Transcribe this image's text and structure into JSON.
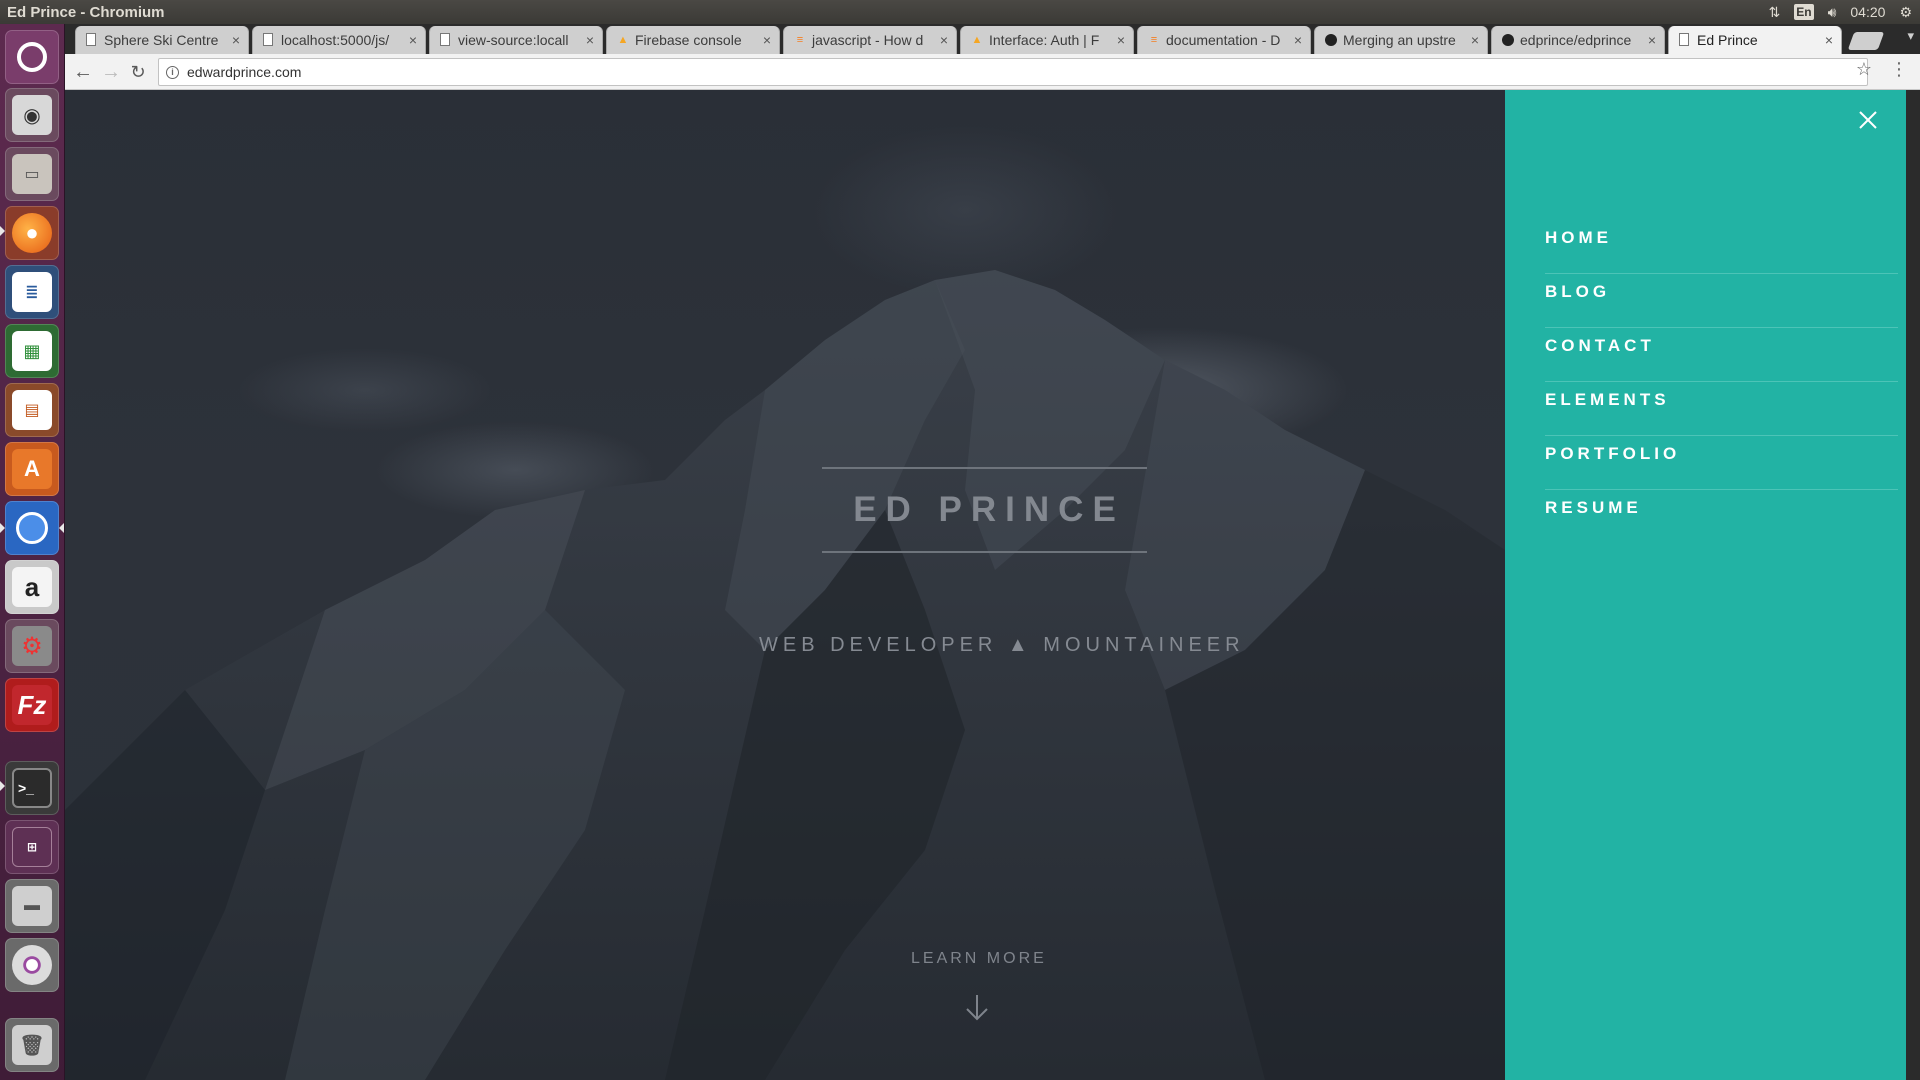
{
  "window": {
    "title": "Ed Prince - Chromium"
  },
  "panel": {
    "lang": "En",
    "clock": "04:20"
  },
  "launcher": {
    "items": [
      {
        "name": "ubuntu-dash-icon"
      },
      {
        "name": "screenshot-camera-icon"
      },
      {
        "name": "files-icon"
      },
      {
        "name": "firefox-icon"
      },
      {
        "name": "writer-icon"
      },
      {
        "name": "calc-icon"
      },
      {
        "name": "impress-icon"
      },
      {
        "name": "software-center-icon"
      },
      {
        "name": "chromium-icon"
      },
      {
        "name": "amazon-icon"
      },
      {
        "name": "system-settings-icon"
      },
      {
        "name": "filezilla-icon"
      },
      {
        "name": "terminal-icon"
      },
      {
        "name": "workspace-switcher-icon"
      },
      {
        "name": "drive-icon"
      },
      {
        "name": "dvd-icon"
      },
      {
        "name": "trash-icon"
      }
    ]
  },
  "tabs": [
    {
      "title": "Sphere Ski Centre",
      "favicon": "doc"
    },
    {
      "title": "localhost:5000/js/",
      "favicon": "doc"
    },
    {
      "title": "view-source:locall",
      "favicon": "doc"
    },
    {
      "title": "Firebase console",
      "favicon": "firebase"
    },
    {
      "title": "javascript - How d",
      "favicon": "stackoverflow"
    },
    {
      "title": "Interface: Auth | F",
      "favicon": "firebase"
    },
    {
      "title": "documentation - D",
      "favicon": "stackoverflow"
    },
    {
      "title": "Merging an upstre",
      "favicon": "github"
    },
    {
      "title": "edprince/edprince",
      "favicon": "github"
    },
    {
      "title": "Ed Prince",
      "favicon": "doc",
      "active": true
    }
  ],
  "toolbar": {
    "url": "edwardprince.com"
  },
  "hero": {
    "title": "ED PRINCE",
    "subtitle": "WEB DEVELOPER ▲ MOUNTAINEER",
    "cta": "LEARN MORE"
  },
  "nav": {
    "items": [
      {
        "label": "HOME"
      },
      {
        "label": "BLOG"
      },
      {
        "label": "CONTACT"
      },
      {
        "label": "ELEMENTS"
      },
      {
        "label": "PORTFOLIO"
      },
      {
        "label": "RESUME"
      }
    ]
  },
  "colors": {
    "panel_teal": "#22b3a4",
    "hero_bg": "#2c3139",
    "launcher": "#4e2444"
  }
}
